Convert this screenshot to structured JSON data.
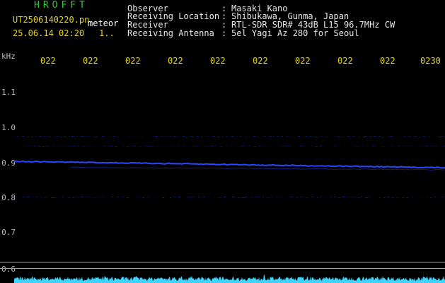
{
  "header": {
    "station_logo": "HROFFT",
    "file_name": "UT2506140220.pn",
    "tag": "meteor",
    "datetime": "25.06.14 02:20",
    "page_marker": "1..",
    "info_rows": [
      {
        "label": "Observer",
        "value": "Masaki Kano"
      },
      {
        "label": "Receiving Location",
        "value": "Shibukawa, Gunma, Japan"
      },
      {
        "label": "Receiver",
        "value": "RTL-SDR SDR# 43dB L15 96.7MHz CW"
      },
      {
        "label": "Receiving Antenna",
        "value": "5el Yagi Az 280 for Seoul"
      }
    ],
    "separator": ":"
  },
  "axes": {
    "y_unit": "kHz",
    "y_ticks": [
      "1.1",
      "1.0",
      "0.9",
      "0.8",
      "0.7",
      "0.6"
    ],
    "x_ticks": [
      "022",
      "022",
      "022",
      "022",
      "022",
      "022",
      "022",
      "022",
      "022",
      "0230"
    ]
  },
  "colors": {
    "background": "#000000",
    "header_green": "#31c831",
    "tick_yellow": "#e6d41e",
    "signal_blue": "#2a46ff",
    "noise_cyan": "#3fd4ff",
    "border_grey": "#a0a0a0"
  }
}
